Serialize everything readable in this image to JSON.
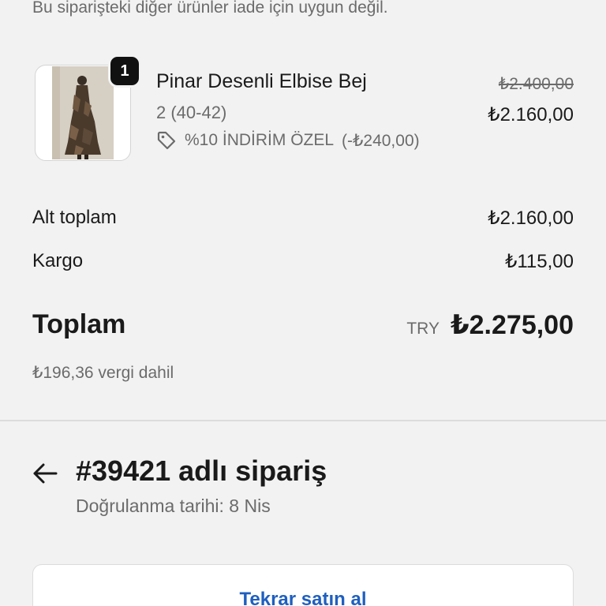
{
  "notice": "Bu siparişteki diğer ürünler iade için uygun değil.",
  "line_item": {
    "quantity": "1",
    "name": "Pinar Desenli Elbise Bej",
    "variant": "2 (40-42)",
    "discount": "%10 İNDİRİM ÖZEL",
    "discount_amount": "(-₺240,00)",
    "price_original": "₺2.400,00",
    "price_final": "₺2.160,00"
  },
  "summary": {
    "subtotal_label": "Alt toplam",
    "subtotal_value": "₺2.160,00",
    "shipping_label": "Kargo",
    "shipping_value": "₺115,00",
    "total_label": "Toplam",
    "total_currency": "TRY",
    "total_value": "₺2.275,00",
    "tax_note": "₺196,36 vergi dahil"
  },
  "order": {
    "title": "#39421 adlı sipariş",
    "confirmed_date": "Doğrulanma tarihi: 8 Nis"
  },
  "actions": {
    "reorder_label": "Tekrar satın al"
  },
  "icons": {
    "back": "back-arrow-icon",
    "tag": "tag-icon"
  },
  "colors": {
    "background": "#f2f2f2",
    "link_blue": "#1f5fbf",
    "muted_text": "#6b6b6b"
  }
}
